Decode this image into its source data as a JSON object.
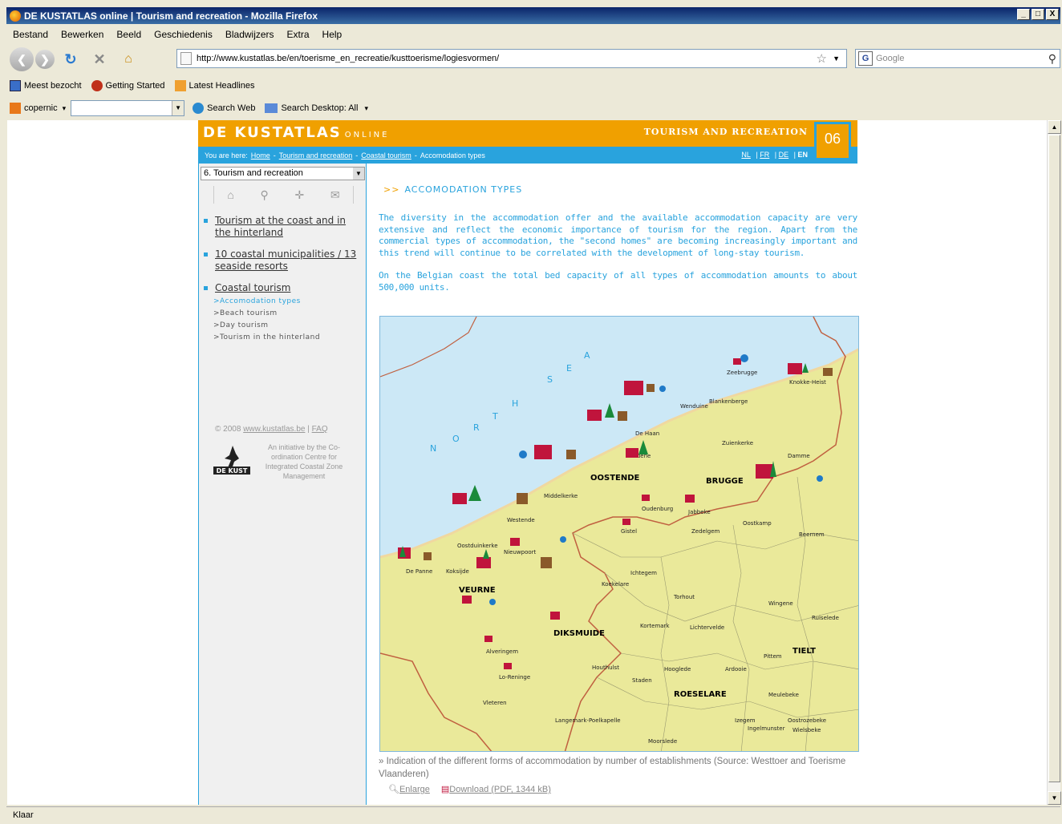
{
  "browser": {
    "title": "DE KUSTATLAS online | Tourism and recreation - Mozilla Firefox",
    "window_buttons": [
      "_",
      "□",
      "X"
    ],
    "menu": [
      "Bestand",
      "Bewerken",
      "Beeld",
      "Geschiedenis",
      "Bladwijzers",
      "Extra",
      "Help"
    ],
    "url": "http://www.kustatlas.be/en/toerisme_en_recreatie/kusttoerisme/logiesvormen/",
    "search_placeholder": "Google",
    "bookmarks": [
      "Meest bezocht",
      "Getting Started",
      "Latest Headlines"
    ],
    "toolbar2": {
      "engine": "copernic",
      "search_web": "Search Web",
      "search_desktop": "Search Desktop: All"
    },
    "status": "Klaar"
  },
  "site": {
    "logo_main": "DE KUSTATLAS",
    "logo_sub": "ONLINE",
    "section": "TOURISM AND RECREATION",
    "section_number": "06",
    "breadcrumb": {
      "prefix": "You are here:",
      "home": "Home",
      "l1": "Tourism and recreation",
      "l2": "Coastal tourism",
      "current": "Accomodation types"
    },
    "languages": [
      "NL",
      "FR",
      "DE",
      "EN"
    ],
    "theme_select": "6. Tourism and recreation",
    "menu": [
      {
        "label": "Tourism at the coast and in the hinterland"
      },
      {
        "label": "10 coastal municipalities / 13 seaside resorts"
      },
      {
        "label": "Coastal tourism"
      }
    ],
    "submenu": [
      ">Accomodation types",
      ">Beach tourism",
      ">Day tourism",
      ">Tourism in the hinterland"
    ],
    "copyright": "© 2008",
    "copyright_link": "www.kustatlas.be",
    "faq": "FAQ",
    "initiative": "An initiative by the Co-ordination Centre for Integrated Coastal Zone Management",
    "logo_text": "DE KUST",
    "heading": "ACCOMODATION TYPES",
    "heading_prefix": ">>",
    "para1": "The diversity in the accommodation offer and the available accommodation capacity are very extensive and reflect the economic importance of tourism for the region. Apart from the commercial types of accommodation, the \"second homes\" are becoming increasingly important and this trend will continue to be correlated with the development of long-stay tourism.",
    "para2": "On the Belgian coast the total bed capacity of all types of accommodation amounts to about 500,000 units.",
    "caption": "» Indication of the different forms of accommodation by number of establishments (Source: Westtoer and Toerisme Vlaanderen)",
    "enlarge": "Enlarge",
    "download": "Download (PDF, 1344 kB)"
  },
  "map": {
    "sea_letters": [
      "N",
      "O",
      "R",
      "T",
      "H",
      "S",
      "E",
      "A"
    ],
    "cities": [
      "OOSTENDE",
      "BRUGGE",
      "VEURNE",
      "DIKSMUIDE",
      "ROESELARE",
      "TIELT"
    ],
    "places": [
      "Zeebrugge",
      "Knokke-Heist",
      "Blankenberge",
      "Wenduine",
      "De Haan",
      "Zuienkerke",
      "Damme",
      "Bredene",
      "Middelkerke",
      "Westende",
      "Oudenburg",
      "Jabbeke",
      "Oostkamp",
      "Beernem",
      "Gistel",
      "Zedelgem",
      "Oostduinkerke",
      "Nieuwpoort",
      "De Panne",
      "Koksijde",
      "Ichtegem",
      "Koekelare",
      "Torhout",
      "Wingene",
      "Ruiselede",
      "Kortemark",
      "Lichtervelde",
      "Alveringem",
      "Lo-Reninge",
      "Houthulst",
      "Staden",
      "Hooglede",
      "Ardooie",
      "Pittem",
      "Vleteren",
      "Langemark-Poelkapelle",
      "Izegem",
      "Ingelmunster",
      "Meulebeke",
      "Oostrozebeke",
      "Wielsbeke",
      "Moorslede"
    ]
  }
}
